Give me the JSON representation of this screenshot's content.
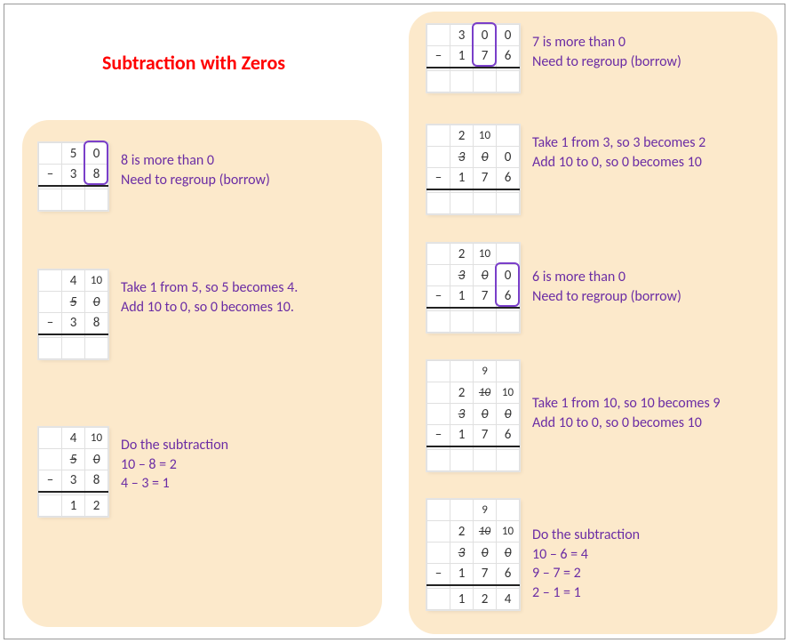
{
  "title": "Subtraction with Zeros",
  "left": {
    "step1": {
      "explain": "8 is more than 0\nNeed to regroup (borrow)",
      "grid": {
        "r1": [
          "",
          "5",
          "0"
        ],
        "r2": [
          "–",
          "3",
          "8"
        ],
        "r3": [
          "",
          "",
          ""
        ]
      },
      "highlight": {
        "col": 2,
        "row": 0,
        "span": 2
      }
    },
    "step2": {
      "explain": "Take 1 from 5, so 5 becomes 4.\nAdd 10 to 0, so 0 becomes 10.",
      "grid": {
        "r1": [
          "",
          "4",
          "10"
        ],
        "r2_red": [
          "",
          "5",
          "0"
        ],
        "r3": [
          "–",
          "3",
          "8"
        ],
        "r4": [
          "",
          "",
          ""
        ]
      }
    },
    "step3": {
      "explain": "Do the subtraction\n10 – 8 = 2\n4 – 3 = 1",
      "grid": {
        "r1": [
          "",
          "4",
          "10"
        ],
        "r2_red": [
          "",
          "5",
          "0"
        ],
        "r3": [
          "–",
          "3",
          "8"
        ],
        "r4": [
          "",
          "1",
          "2"
        ]
      }
    }
  },
  "right": {
    "step1": {
      "explain": "7 is more than 0\nNeed to regroup (borrow)",
      "grid": {
        "r1": [
          "",
          "3",
          "0",
          "0"
        ],
        "r2": [
          "–",
          "1",
          "7",
          "6"
        ],
        "r3": [
          "",
          "",
          "",
          ""
        ]
      },
      "highlight": {
        "col": 2,
        "row": 0,
        "span": 2
      }
    },
    "step2": {
      "explain": "Take 1 from 3, so 3 becomes 2\nAdd 10 to 0, so 0 becomes 10",
      "grid": {
        "r1": [
          "",
          "2",
          "10",
          ""
        ],
        "r2_red": [
          "",
          "3",
          "0",
          "0"
        ],
        "r3": [
          "–",
          "1",
          "7",
          "6"
        ],
        "r4": [
          "",
          "",
          "",
          ""
        ]
      },
      "r2_red_last_plain": true
    },
    "step3": {
      "explain": "6 is more than 0\nNeed to regroup (borrow)",
      "grid": {
        "r1": [
          "",
          "2",
          "10",
          ""
        ],
        "r2_red": [
          "",
          "3",
          "0",
          "0"
        ],
        "r3": [
          "–",
          "1",
          "7",
          "6"
        ],
        "r4": [
          "",
          "",
          "",
          ""
        ]
      },
      "r2_red_last_plain": true,
      "highlight": {
        "col": 3,
        "row": 1,
        "span": 2
      }
    },
    "step4": {
      "explain": "Take 1 from 10, so 10 becomes 9\nAdd 10 to 0, so 0 becomes 10",
      "grid": {
        "r0": [
          "",
          "",
          "9",
          ""
        ],
        "r1": [
          "",
          "2",
          "10",
          "10"
        ],
        "r2_red": [
          "",
          "3",
          "0",
          "0"
        ],
        "r3": [
          "–",
          "1",
          "7",
          "6"
        ],
        "r4": [
          "",
          "",
          "",
          ""
        ]
      },
      "r1_strike_cols": [
        2
      ]
    },
    "step5": {
      "explain": "Do the subtraction\n10 – 6 = 4\n9 – 7 = 2\n2 – 1 = 1",
      "grid": {
        "r0": [
          "",
          "",
          "9",
          ""
        ],
        "r1": [
          "",
          "2",
          "10",
          "10"
        ],
        "r2_red": [
          "",
          "3",
          "0",
          "0"
        ],
        "r3": [
          "–",
          "1",
          "7",
          "6"
        ],
        "r4": [
          "",
          "1",
          "2",
          "4"
        ]
      },
      "r1_strike_cols": [
        2
      ]
    }
  }
}
